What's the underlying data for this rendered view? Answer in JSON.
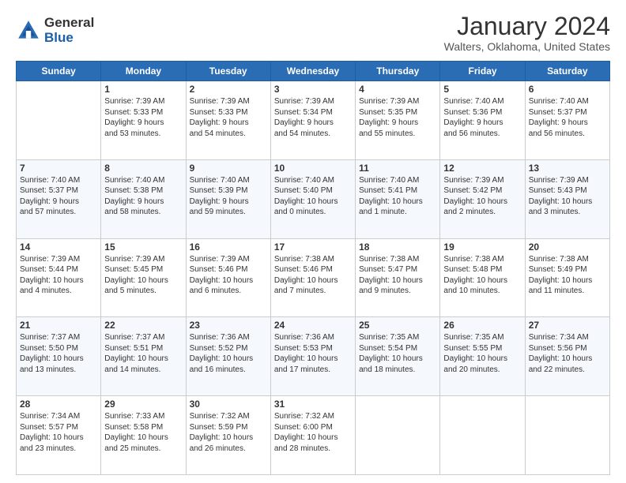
{
  "logo": {
    "general": "General",
    "blue": "Blue"
  },
  "title": "January 2024",
  "location": "Walters, Oklahoma, United States",
  "days_of_week": [
    "Sunday",
    "Monday",
    "Tuesday",
    "Wednesday",
    "Thursday",
    "Friday",
    "Saturday"
  ],
  "weeks": [
    [
      {
        "day": "",
        "info": ""
      },
      {
        "day": "1",
        "info": "Sunrise: 7:39 AM\nSunset: 5:33 PM\nDaylight: 9 hours\nand 53 minutes."
      },
      {
        "day": "2",
        "info": "Sunrise: 7:39 AM\nSunset: 5:33 PM\nDaylight: 9 hours\nand 54 minutes."
      },
      {
        "day": "3",
        "info": "Sunrise: 7:39 AM\nSunset: 5:34 PM\nDaylight: 9 hours\nand 54 minutes."
      },
      {
        "day": "4",
        "info": "Sunrise: 7:39 AM\nSunset: 5:35 PM\nDaylight: 9 hours\nand 55 minutes."
      },
      {
        "day": "5",
        "info": "Sunrise: 7:40 AM\nSunset: 5:36 PM\nDaylight: 9 hours\nand 56 minutes."
      },
      {
        "day": "6",
        "info": "Sunrise: 7:40 AM\nSunset: 5:37 PM\nDaylight: 9 hours\nand 56 minutes."
      }
    ],
    [
      {
        "day": "7",
        "info": "Sunrise: 7:40 AM\nSunset: 5:37 PM\nDaylight: 9 hours\nand 57 minutes."
      },
      {
        "day": "8",
        "info": "Sunrise: 7:40 AM\nSunset: 5:38 PM\nDaylight: 9 hours\nand 58 minutes."
      },
      {
        "day": "9",
        "info": "Sunrise: 7:40 AM\nSunset: 5:39 PM\nDaylight: 9 hours\nand 59 minutes."
      },
      {
        "day": "10",
        "info": "Sunrise: 7:40 AM\nSunset: 5:40 PM\nDaylight: 10 hours\nand 0 minutes."
      },
      {
        "day": "11",
        "info": "Sunrise: 7:40 AM\nSunset: 5:41 PM\nDaylight: 10 hours\nand 1 minute."
      },
      {
        "day": "12",
        "info": "Sunrise: 7:39 AM\nSunset: 5:42 PM\nDaylight: 10 hours\nand 2 minutes."
      },
      {
        "day": "13",
        "info": "Sunrise: 7:39 AM\nSunset: 5:43 PM\nDaylight: 10 hours\nand 3 minutes."
      }
    ],
    [
      {
        "day": "14",
        "info": "Sunrise: 7:39 AM\nSunset: 5:44 PM\nDaylight: 10 hours\nand 4 minutes."
      },
      {
        "day": "15",
        "info": "Sunrise: 7:39 AM\nSunset: 5:45 PM\nDaylight: 10 hours\nand 5 minutes."
      },
      {
        "day": "16",
        "info": "Sunrise: 7:39 AM\nSunset: 5:46 PM\nDaylight: 10 hours\nand 6 minutes."
      },
      {
        "day": "17",
        "info": "Sunrise: 7:38 AM\nSunset: 5:46 PM\nDaylight: 10 hours\nand 7 minutes."
      },
      {
        "day": "18",
        "info": "Sunrise: 7:38 AM\nSunset: 5:47 PM\nDaylight: 10 hours\nand 9 minutes."
      },
      {
        "day": "19",
        "info": "Sunrise: 7:38 AM\nSunset: 5:48 PM\nDaylight: 10 hours\nand 10 minutes."
      },
      {
        "day": "20",
        "info": "Sunrise: 7:38 AM\nSunset: 5:49 PM\nDaylight: 10 hours\nand 11 minutes."
      }
    ],
    [
      {
        "day": "21",
        "info": "Sunrise: 7:37 AM\nSunset: 5:50 PM\nDaylight: 10 hours\nand 13 minutes."
      },
      {
        "day": "22",
        "info": "Sunrise: 7:37 AM\nSunset: 5:51 PM\nDaylight: 10 hours\nand 14 minutes."
      },
      {
        "day": "23",
        "info": "Sunrise: 7:36 AM\nSunset: 5:52 PM\nDaylight: 10 hours\nand 16 minutes."
      },
      {
        "day": "24",
        "info": "Sunrise: 7:36 AM\nSunset: 5:53 PM\nDaylight: 10 hours\nand 17 minutes."
      },
      {
        "day": "25",
        "info": "Sunrise: 7:35 AM\nSunset: 5:54 PM\nDaylight: 10 hours\nand 18 minutes."
      },
      {
        "day": "26",
        "info": "Sunrise: 7:35 AM\nSunset: 5:55 PM\nDaylight: 10 hours\nand 20 minutes."
      },
      {
        "day": "27",
        "info": "Sunrise: 7:34 AM\nSunset: 5:56 PM\nDaylight: 10 hours\nand 22 minutes."
      }
    ],
    [
      {
        "day": "28",
        "info": "Sunrise: 7:34 AM\nSunset: 5:57 PM\nDaylight: 10 hours\nand 23 minutes."
      },
      {
        "day": "29",
        "info": "Sunrise: 7:33 AM\nSunset: 5:58 PM\nDaylight: 10 hours\nand 25 minutes."
      },
      {
        "day": "30",
        "info": "Sunrise: 7:32 AM\nSunset: 5:59 PM\nDaylight: 10 hours\nand 26 minutes."
      },
      {
        "day": "31",
        "info": "Sunrise: 7:32 AM\nSunset: 6:00 PM\nDaylight: 10 hours\nand 28 minutes."
      },
      {
        "day": "",
        "info": ""
      },
      {
        "day": "",
        "info": ""
      },
      {
        "day": "",
        "info": ""
      }
    ]
  ]
}
